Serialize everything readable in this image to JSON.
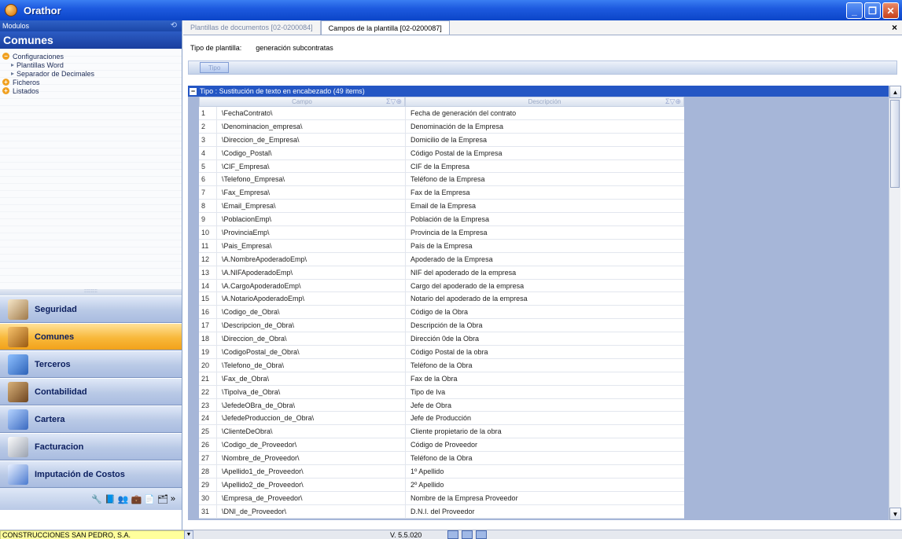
{
  "window": {
    "title": "Orathor"
  },
  "left": {
    "modulos_label": "Modulos",
    "section_title": "Comunes",
    "tree": [
      {
        "label": "Configuraciones",
        "type": "branch",
        "symbol": "−"
      },
      {
        "label": "Plantillas Word",
        "type": "leaf"
      },
      {
        "label": "Separador de Decimales",
        "type": "leaf"
      },
      {
        "label": "Ficheros",
        "type": "branch",
        "symbol": "+"
      },
      {
        "label": "Listados",
        "type": "branch",
        "symbol": "+"
      }
    ],
    "nav": [
      {
        "label": "Seguridad",
        "icon": "security-icon",
        "active": false
      },
      {
        "label": "Comunes",
        "icon": "common-icon",
        "active": true
      },
      {
        "label": "Terceros",
        "icon": "third-parties-icon",
        "active": false
      },
      {
        "label": "Contabilidad",
        "icon": "accounting-icon",
        "active": false
      },
      {
        "label": "Cartera",
        "icon": "portfolio-icon",
        "active": false
      },
      {
        "label": "Facturacion",
        "icon": "invoice-icon",
        "active": false
      },
      {
        "label": "Imputación de Costos",
        "icon": "cost-allocation-icon",
        "active": false
      }
    ]
  },
  "tabs": [
    {
      "label": "Plantillas de documentos [02-0200084]",
      "active": false
    },
    {
      "label": "Campos de la plantilla [02-0200087]",
      "active": true
    }
  ],
  "tipo": {
    "label": "Tipo de plantilla:",
    "value": "generación subcontratas"
  },
  "group_chip": "Tipo",
  "grid": {
    "group_title": "Tipo : Sustitución de texto en encabezado (49 items)",
    "col_campo": "Campo",
    "col_desc": "Descripción",
    "rows": [
      [
        "1",
        "\\FechaContrato\\",
        "Fecha de generación del contrato"
      ],
      [
        "2",
        "\\Denominacion_empresa\\",
        "Denominación de la Empresa"
      ],
      [
        "3",
        "\\Direccion_de_Empresa\\",
        "Domicilio de la Empresa"
      ],
      [
        "4",
        "\\Codigo_Postal\\",
        "Código Postal de la Empresa"
      ],
      [
        "5",
        "\\CIF_Empresa\\",
        "CIF de la Empresa"
      ],
      [
        "6",
        "\\Telefono_Empresa\\",
        "Teléfono de la Empresa"
      ],
      [
        "7",
        "\\Fax_Empresa\\",
        "Fax de la Empresa"
      ],
      [
        "8",
        "\\Email_Empresa\\",
        "Email de la Empresa"
      ],
      [
        "9",
        "\\PoblacionEmp\\",
        "Población de la Empresa"
      ],
      [
        "10",
        "\\ProvinciaEmp\\",
        "Provincia de la Empresa"
      ],
      [
        "11",
        "\\Pais_Empresa\\",
        "País de la Empresa"
      ],
      [
        "12",
        "\\A.NombreApoderadoEmp\\",
        "Apoderado de la Empresa"
      ],
      [
        "13",
        "\\A.NIFApoderadoEmp\\",
        "NIF del apoderado de la empresa"
      ],
      [
        "14",
        "\\A.CargoApoderadoEmp\\",
        "Cargo del apoderado de la empresa"
      ],
      [
        "15",
        "\\A.NotarioApoderadoEmp\\",
        "Notario del apoderado de la empresa"
      ],
      [
        "16",
        "\\Codigo_de_Obra\\",
        "Código de la Obra"
      ],
      [
        "17",
        "\\Descripcion_de_Obra\\",
        "Descripción de la Obra"
      ],
      [
        "18",
        "\\Direccion_de_Obra\\",
        "Dirección 0de la Obra"
      ],
      [
        "19",
        "\\CodigoPostal_de_Obra\\",
        "Código Postal de la obra"
      ],
      [
        "20",
        "\\Telefono_de_Obra\\",
        "Teléfono de la Obra"
      ],
      [
        "21",
        "\\Fax_de_Obra\\",
        "Fax de la Obra"
      ],
      [
        "22",
        "\\TipoIva_de_Obra\\",
        "Tipo de Iva"
      ],
      [
        "23",
        "\\JefedeOBra_de_Obra\\",
        "Jefe de Obra"
      ],
      [
        "24",
        "\\JefedeProduccion_de_Obra\\",
        "Jefe de Producción"
      ],
      [
        "25",
        "\\ClienteDeObra\\",
        "Cliente propietario de la obra"
      ],
      [
        "26",
        "\\Codigo_de_Proveedor\\",
        "Código de Proveedor"
      ],
      [
        "27",
        "\\Nombre_de_Proveedor\\",
        "Teléfono de la Obra"
      ],
      [
        "28",
        "\\Apellido1_de_Proveedor\\",
        "1º Apellido"
      ],
      [
        "29",
        "\\Apellido2_de_Proveedor\\",
        "2º Apellido"
      ],
      [
        "30",
        "\\Empresa_de_Proveedor\\",
        "Nombre de la Empresa Proveedor"
      ],
      [
        "31",
        "\\DNI_de_Proveedor\\",
        "D.N.I. del Proveedor"
      ]
    ]
  },
  "status": {
    "company": "CONSTRUCCIONES SAN PEDRO, S.A.",
    "version": "V. 5.5.020"
  },
  "colors": {
    "title": "#1e5be0",
    "group": "#2456c4",
    "active_nav": "#f8b83a",
    "company_bg": "#ffff9c"
  }
}
